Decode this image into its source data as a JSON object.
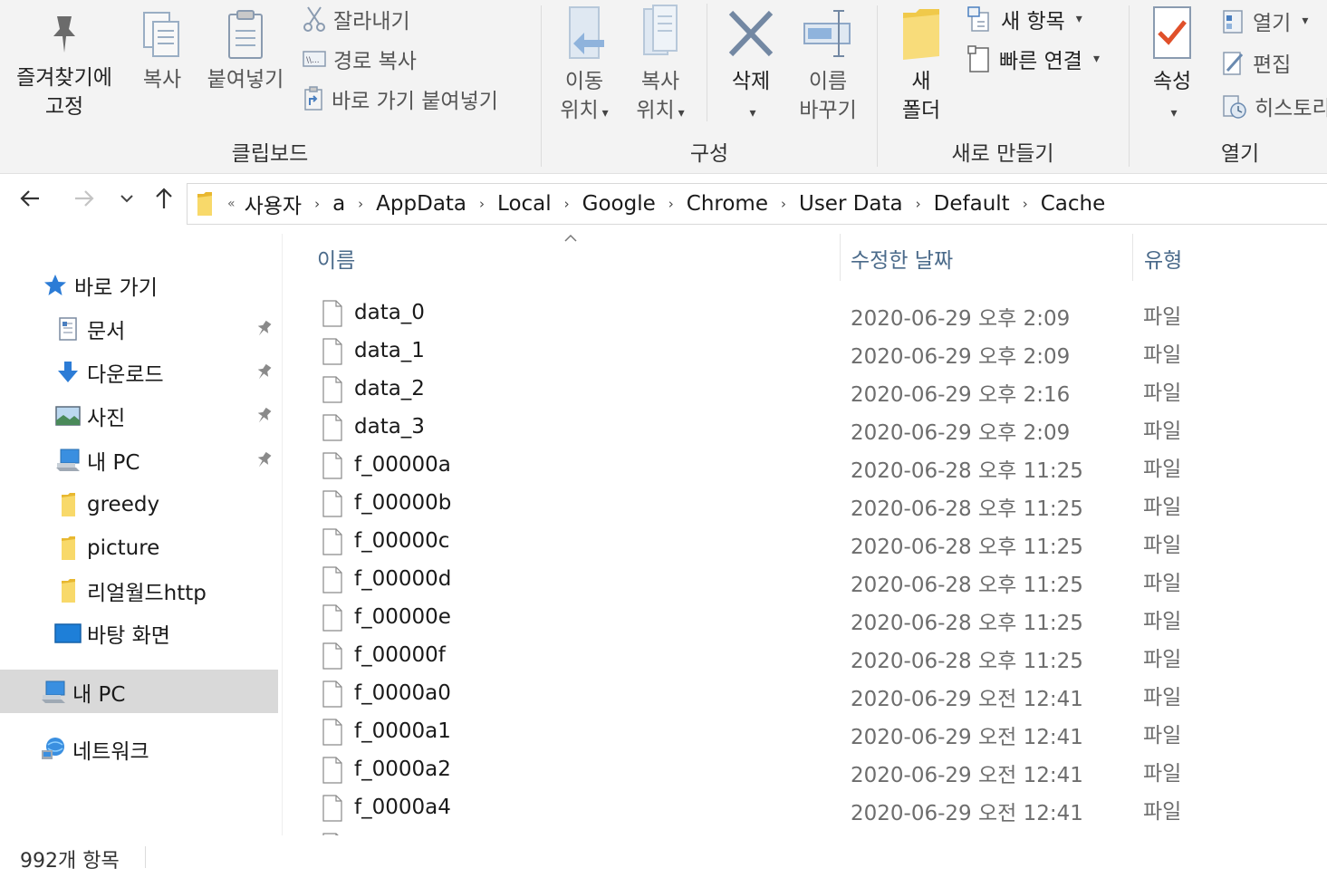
{
  "ribbon": {
    "clipboard": {
      "label": "클립보드",
      "pin_line1": "즐겨찾기에",
      "pin_line2": "고정",
      "copy": "복사",
      "paste": "붙여넣기",
      "cut": "잘라내기",
      "copy_path": "경로 복사",
      "paste_shortcut": "바로 가기 붙여넣기"
    },
    "organize": {
      "label": "구성",
      "move_line1": "이동",
      "move_line2": "위치",
      "copyto_line1": "복사",
      "copyto_line2": "위치",
      "delete": "삭제",
      "rename_line1": "이름",
      "rename_line2": "바꾸기"
    },
    "new": {
      "label": "새로 만들기",
      "folder_line1": "새",
      "folder_line2": "폴더",
      "new_item": "새 항목",
      "easy_access": "빠른 연결"
    },
    "open": {
      "label": "열기",
      "properties": "속성",
      "open": "열기",
      "edit": "편집",
      "history": "히스토리"
    }
  },
  "address": {
    "overflow": "«",
    "crumbs": [
      "사용자",
      "a",
      "AppData",
      "Local",
      "Google",
      "Chrome",
      "User Data",
      "Default",
      "Cache"
    ]
  },
  "nav": {
    "quick_access": "바로 가기",
    "items": [
      "문서",
      "다운로드",
      "사진",
      "내 PC",
      "greedy",
      "picture",
      "리얼월드http",
      "바탕 화면"
    ],
    "this_pc": "내 PC",
    "network": "네트워크"
  },
  "columns": {
    "name": "이름",
    "date": "수정한 날짜",
    "type": "유형"
  },
  "files": [
    {
      "name": "data_0",
      "date": "2020-06-29 오후 2:09",
      "type": "파일"
    },
    {
      "name": "data_1",
      "date": "2020-06-29 오후 2:09",
      "type": "파일"
    },
    {
      "name": "data_2",
      "date": "2020-06-29 오후 2:16",
      "type": "파일"
    },
    {
      "name": "data_3",
      "date": "2020-06-29 오후 2:09",
      "type": "파일"
    },
    {
      "name": "f_00000a",
      "date": "2020-06-28 오후 11:25",
      "type": "파일"
    },
    {
      "name": "f_00000b",
      "date": "2020-06-28 오후 11:25",
      "type": "파일"
    },
    {
      "name": "f_00000c",
      "date": "2020-06-28 오후 11:25",
      "type": "파일"
    },
    {
      "name": "f_00000d",
      "date": "2020-06-28 오후 11:25",
      "type": "파일"
    },
    {
      "name": "f_00000e",
      "date": "2020-06-28 오후 11:25",
      "type": "파일"
    },
    {
      "name": "f_00000f",
      "date": "2020-06-28 오후 11:25",
      "type": "파일"
    },
    {
      "name": "f_0000a0",
      "date": "2020-06-29 오전 12:41",
      "type": "파일"
    },
    {
      "name": "f_0000a1",
      "date": "2020-06-29 오전 12:41",
      "type": "파일"
    },
    {
      "name": "f_0000a2",
      "date": "2020-06-29 오전 12:41",
      "type": "파일"
    },
    {
      "name": "f_0000a4",
      "date": "2020-06-29 오전 12:41",
      "type": "파일"
    }
  ],
  "status": {
    "count": "992개 항목"
  }
}
